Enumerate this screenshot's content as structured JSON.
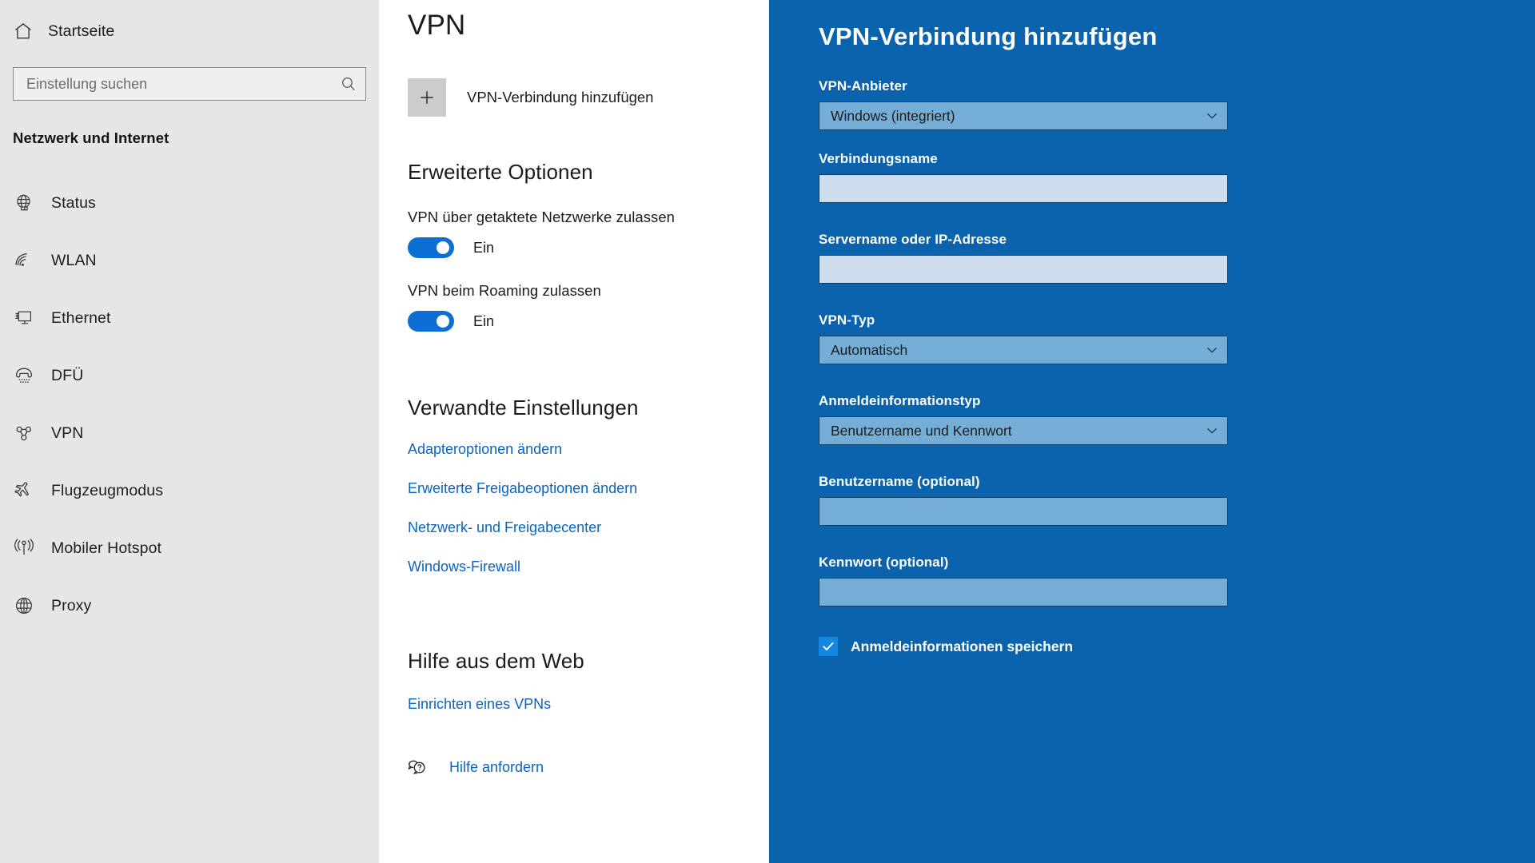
{
  "sidebar": {
    "home": {
      "label": "Startseite",
      "icon": "home-icon"
    },
    "search": {
      "placeholder": "Einstellung suchen",
      "value": "",
      "icon": "search-icon"
    },
    "group_title": "Netzwerk und Internet",
    "items": [
      {
        "label": "Status",
        "icon": "globe-status-icon",
        "selected": false
      },
      {
        "label": "WLAN",
        "icon": "wifi-icon",
        "selected": false
      },
      {
        "label": "Ethernet",
        "icon": "ethernet-icon",
        "selected": false
      },
      {
        "label": "DFÜ",
        "icon": "dialup-phone-icon",
        "selected": false
      },
      {
        "label": "VPN",
        "icon": "vpn-icon",
        "selected": false
      },
      {
        "label": "Flugzeugmodus",
        "icon": "airplane-icon",
        "selected": false
      },
      {
        "label": "Mobiler Hotspot",
        "icon": "hotspot-icon",
        "selected": false
      },
      {
        "label": "Proxy",
        "icon": "globe-proxy-icon",
        "selected": false
      }
    ]
  },
  "content": {
    "page_title": "VPN",
    "add_connection": {
      "label": "VPN-Verbindung hinzufügen",
      "icon": "plus-icon"
    },
    "advanced": {
      "heading": "Erweiterte Optionen",
      "options": [
        {
          "label": "VPN über getaktete Netzwerke zulassen",
          "state": "Ein",
          "on": true
        },
        {
          "label": "VPN beim Roaming zulassen",
          "state": "Ein",
          "on": true
        }
      ]
    },
    "related": {
      "heading": "Verwandte Einstellungen",
      "links": [
        "Adapteroptionen ändern",
        "Erweiterte Freigabeoptionen ändern",
        "Netzwerk- und Freigabecenter",
        "Windows-Firewall"
      ]
    },
    "help": {
      "heading": "Hilfe aus dem Web",
      "links": [
        "Einrichten eines VPNs"
      ],
      "get_help": {
        "label": "Hilfe anfordern",
        "icon": "question-bubble-icon"
      }
    }
  },
  "dialog": {
    "title": "VPN-Verbindung hinzufügen",
    "fields": [
      {
        "label": "VPN-Anbieter",
        "type": "combo",
        "value": "Windows (integriert)"
      },
      {
        "label": "Verbindungsname",
        "type": "text",
        "value": "",
        "placeholder": ""
      },
      {
        "label": "Servername oder IP-Adresse",
        "type": "text",
        "value": "",
        "placeholder": ""
      },
      {
        "label": "VPN-Typ",
        "type": "combo",
        "value": "Automatisch"
      },
      {
        "label": "Anmeldeinformationstyp",
        "type": "combo",
        "value": "Benutzername und Kennwort"
      },
      {
        "label": "Benutzername (optional)",
        "type": "textdim",
        "value": "",
        "placeholder": ""
      },
      {
        "label": "Kennwort (optional)",
        "type": "textdim",
        "value": "",
        "placeholder": ""
      }
    ],
    "checkbox": {
      "label": "Anmeldeinformationen speichern",
      "checked": true
    }
  },
  "colors": {
    "panel_blue": "#0b63ad",
    "accent_blue": "#0b6fd4",
    "link_blue": "#0a64c2",
    "sidebar_gray": "#e6e6e6",
    "field_light": "#cddded",
    "field_dim": "#74aed7",
    "checkbox_blue": "#1487e0"
  }
}
